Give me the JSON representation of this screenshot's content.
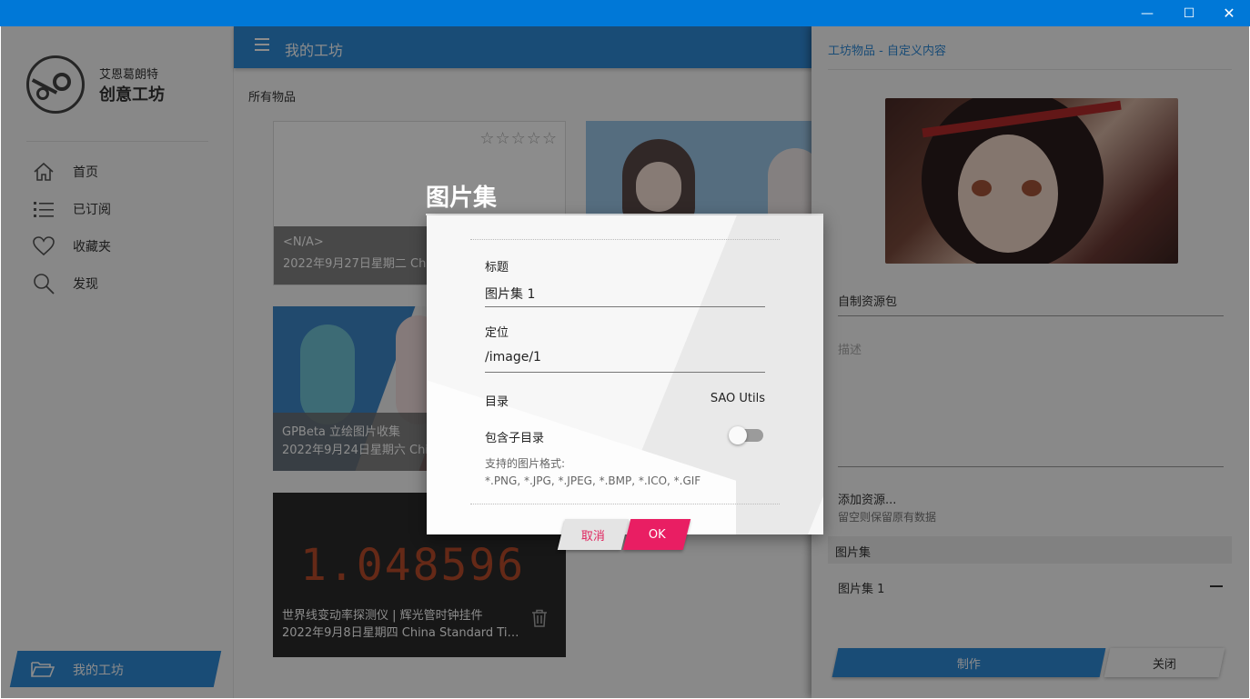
{
  "window": {
    "controls": {
      "minimize": "—",
      "maximize": "☐",
      "close": "✕"
    }
  },
  "sidebar": {
    "brand_line1": "艾恩葛朗特",
    "brand_line2": "创意工坊",
    "items": [
      {
        "label": "首页",
        "icon": "home-icon"
      },
      {
        "label": "已订阅",
        "icon": "list-icon"
      },
      {
        "label": "收藏夹",
        "icon": "heart-icon"
      },
      {
        "label": "发现",
        "icon": "search-icon"
      }
    ],
    "active_item": {
      "label": "我的工坊",
      "icon": "folder-open-icon"
    }
  },
  "header": {
    "title": "我的工坊"
  },
  "main": {
    "section_label": "所有物品",
    "cards": [
      {
        "title": "<N/A>",
        "subtitle": "2022年9月27日星期二 China Standard Time",
        "stars": "☆☆☆☆☆"
      },
      {
        "title": "",
        "subtitle": ""
      },
      {
        "title": "GPBeta 立绘图片收集",
        "subtitle": "2022年9月24日星期六 China Standard Time"
      },
      {
        "title": "世界线变动率探测仪 | 辉光管时钟挂件",
        "subtitle": "2022年9月8日星期四 China Standard Ti…",
        "display": "1.048596"
      }
    ]
  },
  "right_panel": {
    "title": "工坊物品 - 自定义内容",
    "name_value": "自制资源包",
    "description_placeholder": "描述",
    "add_resource": "添加资源...",
    "add_hint": "留空则保留原有数据",
    "gallery_header": "图片集",
    "gallery_item": "图片集 1",
    "make_button": "制作",
    "close_button": "关闭"
  },
  "dialog": {
    "title": "图片集",
    "field_title_label": "标题",
    "field_title_value": "图片集 1",
    "field_location_label": "定位",
    "field_location_value": "/image/1",
    "directory_label": "目录",
    "directory_value": "SAO Utils",
    "subdir_label": "包含子目录",
    "subdir_enabled": false,
    "formats_label": "支持的图片格式:",
    "formats_value": "*.PNG, *.JPG, *.JPEG, *.BMP, *.ICO, *.GIF",
    "cancel_button": "取消",
    "ok_button": "OK"
  },
  "colors": {
    "titlebar": "#0078d7",
    "accent": "#2f8ad8",
    "ok_button": "#e91e63",
    "cancel_text": "#e0245e"
  }
}
